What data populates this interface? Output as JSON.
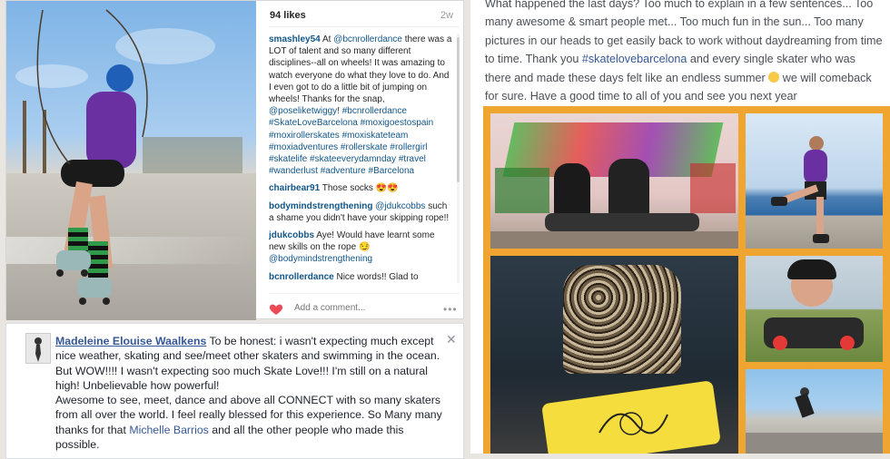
{
  "instagram": {
    "likes": "94 likes",
    "time_ago": "2w",
    "post": {
      "user": "smashley54",
      "text_1": "At ",
      "mention_1": "@bcnrollerdance",
      "text_2": " there was a LOT of talent and so many different disciplines--all on wheels! It was amazing to watch everyone do what they love to do. And I even got to do a little bit of jumping on wheels! Thanks for the snap, ",
      "mention_2": "@poseliketwiggy",
      "text_3": "!",
      "hashtags": "#bcnrollerdance #SkateLoveBarcelona #moxigoestospain #moxirollerskates #moxiskateteam #moxiadventures #rollerskate #rollergirl #skatelife #skateeverydamnday #travel #wanderlust #adventure #Barcelona"
    },
    "comments": [
      {
        "user": "chairbear91",
        "text": "Those socks 😍😍"
      },
      {
        "user": "bodymindstrengthening",
        "mention": "@jdukcobbs",
        "text": " such a shame you didn't have your skipping rope!!"
      },
      {
        "user": "jdukcobbs",
        "text": "Aye! Would have learnt some new skills on the rope 😏 ",
        "mention": "@bodymindstrengthening"
      },
      {
        "user": "bcnrollerdance",
        "text": "Nice words!! Glad to"
      }
    ],
    "comment_placeholder": "Add a comment...",
    "more": "•••"
  },
  "facebook": {
    "name": "Madeleine Elouise Waalkens",
    "text_1": " To be honest: i wasn't expecting much except nice weather, skating and see/meet other skaters and swimming in the ocean. But WOW!!!! I wasn't expecting soo much Skate Love!!! I'm still on a natural high! Unbelievable how powerful!",
    "text_2": "Awesome to see, meet, dance and above all CONNECT with so many skaters from all over the world. I feel really blessed for this experience. So Many many thanks for that ",
    "mention": "Michelle Barrios",
    "text_3": " and all the other people who made this possible.",
    "close": "✕"
  },
  "right_post": {
    "text_1": "What happened the last days? Too much to explain in a few sentences... Too many awesome & smart people met... Too much fun in the sun... Too many pictures in our heads to get easily back to work without daydreaming from time to time. Thank you ",
    "hashtag": "#skatelovebarcelona",
    "text_2": " and every single skater who was there and made these days felt like an endless summer ",
    "text_3": " we will comeback for sure. Have a good time to all of you and see you next year"
  },
  "colors": {
    "collage_border": "#f0a530",
    "link_blue": "#365899",
    "ig_link": "#125688"
  }
}
